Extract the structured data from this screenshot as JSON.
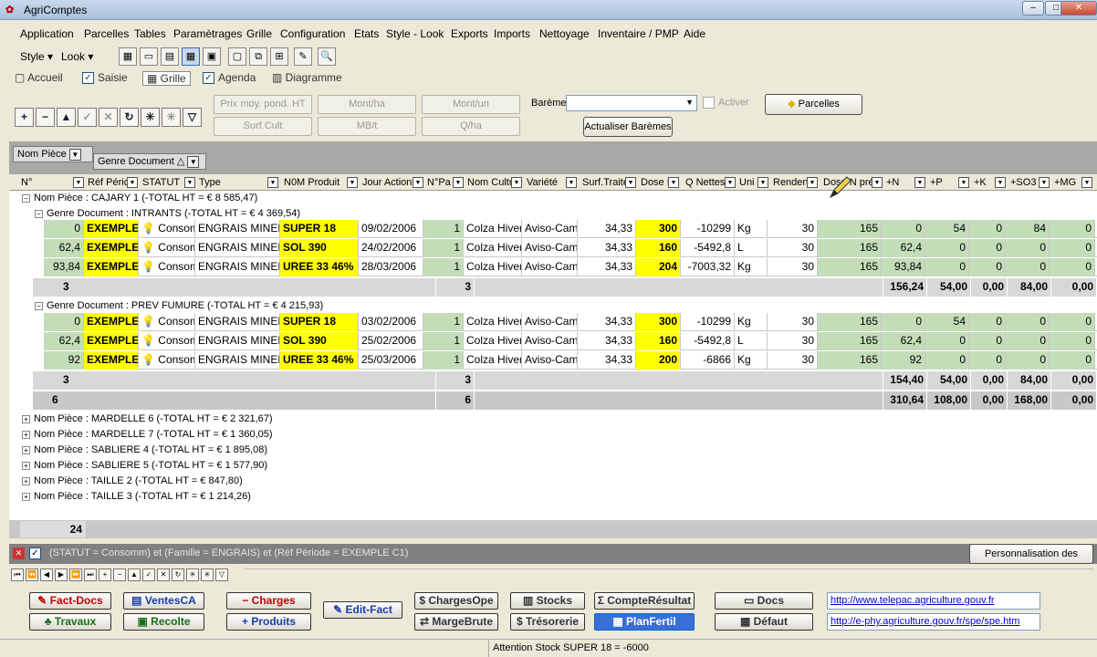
{
  "window": {
    "title": "AgriComptes"
  },
  "menu": [
    "Application",
    "Parcelles",
    "Tables",
    "Paramètrages",
    "Grille",
    "Configuration",
    "Etats",
    "Style - Look",
    "Exports",
    "Imports",
    "Nettoyage",
    "Inventaire / PMP",
    "Aide"
  ],
  "toolbar": {
    "style": "Style",
    "look": "Look"
  },
  "tabs": {
    "accueil": "Accueil",
    "saisie": "Saisie",
    "grille": "Grille",
    "agenda": "Agenda",
    "diagramme": "Diagramme"
  },
  "calc_buttons": {
    "prix": "Prix moy. pond. HT",
    "mont_ha": "Mont/ha",
    "mont_un": "Mont/un",
    "surf": "Surf.Cult",
    "mbt": "MB/t",
    "qha": "Q/ha"
  },
  "bareme": {
    "label": "Barème",
    "activer": "Activer",
    "actualiser": "Actualiser Barèmes",
    "parcelles": "Parcelles"
  },
  "group_fields": {
    "nom_piece": "Nom Pièce",
    "genre": "Genre Document"
  },
  "headers": [
    "N°",
    "Réf Péric",
    "STATUT",
    "Type",
    "N0M Produit",
    "Jour Action",
    "N°Pa",
    "Nom Cultu",
    "Variété",
    "Surf.Traité",
    "Dose I",
    "Q Nettes",
    "Uni",
    "Renden",
    "Dose N pré",
    "+N",
    "+P",
    "+K",
    "+SO3",
    "+MG"
  ],
  "groups": {
    "cajary": "Nom Pièce : CAJARY 1 (-TOTAL HT = € 8 585,47)",
    "intrants": "Genre Document : INTRANTS (-TOTAL HT = € 4 369,54)",
    "prev": "Genre Document : PREV FUMURE (-TOTAL HT = € 4 215,93)"
  },
  "rows_intrants": [
    {
      "n": "0",
      "ref": "EXEMPLE",
      "statut": "Consom",
      "type": "ENGRAIS MINERA",
      "prod": "SUPER 18",
      "date": "09/02/2006",
      "npa": "1",
      "cult": "Colza Hiver A",
      "var": "Aviso-Camp",
      "surf": "34,33",
      "dose": "300",
      "q": "-10299",
      "uni": "Kg",
      "rend": "30",
      "dn": "165",
      "p": "54",
      "k": "0",
      "so3": "84",
      "mg": "0"
    },
    {
      "n": "62,4",
      "ref": "EXEMPLE",
      "statut": "Consom",
      "type": "ENGRAIS MINERA",
      "prod": "SOL 390",
      "date": "24/02/2006",
      "npa": "1",
      "cult": "Colza Hiver A",
      "var": "Aviso-Camp",
      "surf": "34,33",
      "dose": "160",
      "q": "-5492,8",
      "uni": "L",
      "rend": "30",
      "dn": "165",
      "p": "0",
      "k": "0",
      "so3": "0",
      "mg": "0"
    },
    {
      "n": "93,84",
      "ref": "EXEMPLE",
      "statut": "Consom",
      "type": "ENGRAIS MINERA",
      "prod": "UREE 33 46%",
      "date": "28/03/2006",
      "npa": "1",
      "cult": "Colza Hiver A",
      "var": "Aviso-Camp",
      "surf": "34,33",
      "dose": "204",
      "q": "-7003,32",
      "uni": "Kg",
      "rend": "30",
      "dn": "165",
      "p": "0",
      "k": "0",
      "so3": "0",
      "mg": "0"
    }
  ],
  "sum_intrants": {
    "count": "3",
    "npa": "3",
    "n": "156,24",
    "p": "54,00",
    "k": "0,00",
    "so3": "84,00",
    "mg": "0,00"
  },
  "rows_prev": [
    {
      "n": "0",
      "ref": "EXEMPLE",
      "statut": "Consom",
      "type": "ENGRAIS MINERA",
      "prod": "SUPER 18",
      "date": "03/02/2006",
      "npa": "1",
      "cult": "Colza Hiver A",
      "var": "Aviso-Camp",
      "surf": "34,33",
      "dose": "300",
      "q": "-10299",
      "uni": "Kg",
      "rend": "30",
      "dn": "165",
      "p": "54",
      "k": "0",
      "so3": "0",
      "mg": "0"
    },
    {
      "n": "62,4",
      "ref": "EXEMPLE",
      "statut": "Consom",
      "type": "ENGRAIS MINERA",
      "prod": "SOL 390",
      "date": "25/02/2006",
      "npa": "1",
      "cult": "Colza Hiver A",
      "var": "Aviso-Camp",
      "surf": "34,33",
      "dose": "160",
      "q": "-5492,8",
      "uni": "L",
      "rend": "30",
      "dn": "165",
      "p": "0",
      "k": "0",
      "so3": "0",
      "mg": "0"
    },
    {
      "n": "92",
      "ref": "EXEMPLE",
      "statut": "Consom",
      "type": "ENGRAIS MINERA",
      "prod": "UREE 33 46%",
      "date": "25/03/2006",
      "npa": "1",
      "cult": "Colza Hiver A",
      "var": "Aviso-Camp",
      "surf": "34,33",
      "dose": "200",
      "q": "-6866",
      "uni": "Kg",
      "rend": "30",
      "dn": "165",
      "p": "0",
      "k": "0",
      "so3": "0",
      "mg": "0"
    }
  ],
  "sum_prev": {
    "count": "3",
    "npa": "3",
    "n": "154,40",
    "p": "54,00",
    "k": "0,00",
    "so3": "84,00",
    "mg": "0,00"
  },
  "sum_cajary": {
    "count": "6",
    "npa": "6",
    "n": "310,64",
    "p": "108,00",
    "k": "0,00",
    "so3": "168,00",
    "mg": "0,00"
  },
  "collapsed": [
    "Nom Pièce : MARDELLE 6 (-TOTAL HT = € 2 321,67)",
    "Nom Pièce : MARDELLE 7 (-TOTAL HT = € 1 360,05)",
    "Nom Pièce : SABLIERE 4 (-TOTAL HT = € 1 895,08)",
    "Nom Pièce : SABLIERE 5 (-TOTAL HT = € 1 577,90)",
    "Nom Pièce : TAILLE 2 (-TOTAL HT = € 847,80)",
    "Nom Pièce : TAILLE 3 (-TOTAL HT = € 1 214,26)"
  ],
  "total_count": "24",
  "filter": {
    "text": "(STATUT = Consomm) et (Famille = ENGRAIS) et (Réf Période = EXEMPLE C1)",
    "personnaliser": "Personnalisation des filtres..."
  },
  "bottom": {
    "fact_docs": "Fact-Docs",
    "ventes": "VentesCA",
    "charges": "Charges",
    "edit_fact": "Edit-Fact",
    "chargesope": "ChargesOpe",
    "stocks": "Stocks",
    "compte": "CompteRésultat",
    "docs": "Docs",
    "travaux": "Travaux",
    "recolte": "Recolte",
    "produits": "Produits",
    "marge": "MargeBrute",
    "tresorerie": "Trésorerie",
    "planfertil": "PlanFertil",
    "defaut": "Défaut"
  },
  "links": {
    "l1": "http://www.telepac.agriculture.gouv.fr",
    "l2": "http://e-phy.agriculture.gouv.fr/spe/spe.htm"
  },
  "status": "Attention Stock SUPER 18 = -6000",
  "colors": {
    "green": "#c4ddb9",
    "yellow": "#ffff00",
    "title": "#a9c1de"
  }
}
